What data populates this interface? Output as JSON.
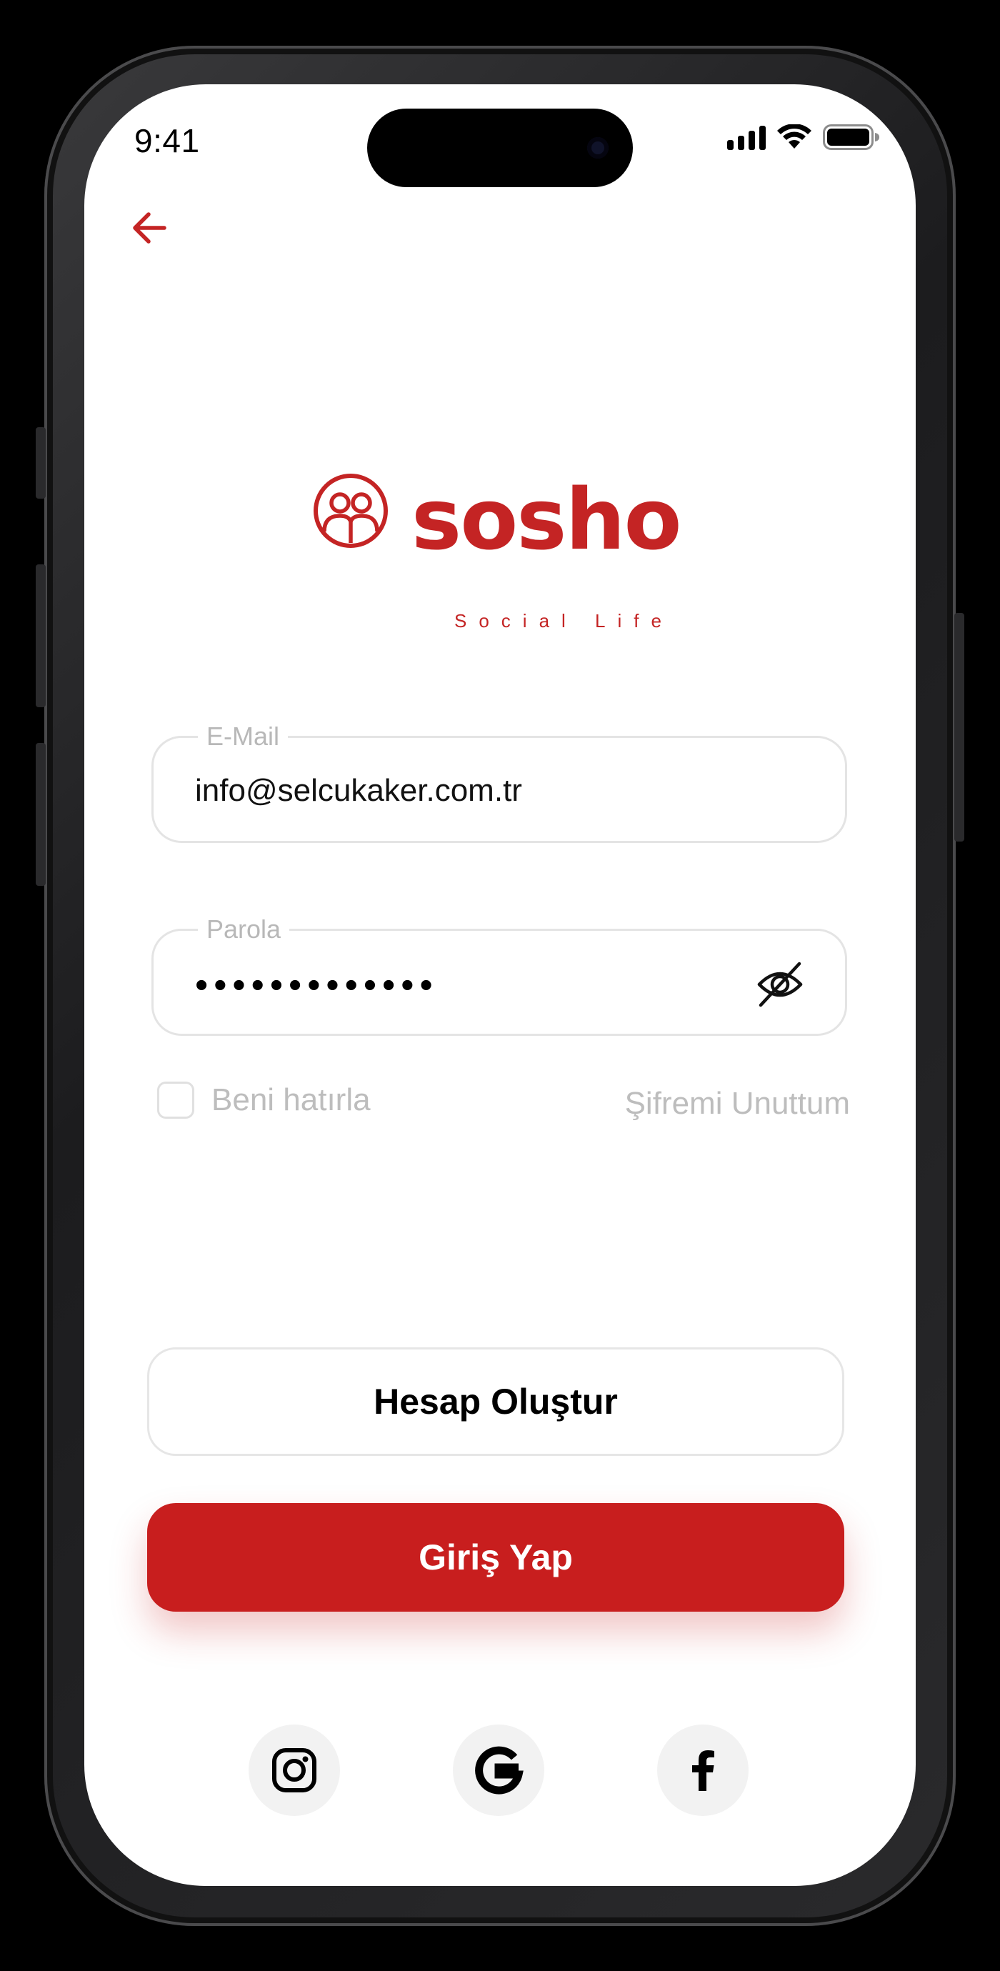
{
  "status_bar": {
    "time": "9:41"
  },
  "brand": {
    "name": "sosho",
    "tagline": "Social Life",
    "color": "#c42424"
  },
  "form": {
    "email": {
      "label": "E-Mail",
      "value": "info@selcukaker.com.tr"
    },
    "password": {
      "label": "Parola",
      "masked_value": "•••••••••••••"
    },
    "remember_label": "Beni hatırla",
    "forgot_label": "Şifremi Unuttum"
  },
  "actions": {
    "create_account_label": "Hesap Oluştur",
    "login_label": "Giriş Yap",
    "primary_color": "#c81e1e"
  },
  "social": [
    {
      "icon": "instagram-icon"
    },
    {
      "icon": "google-icon"
    },
    {
      "icon": "facebook-icon"
    }
  ]
}
